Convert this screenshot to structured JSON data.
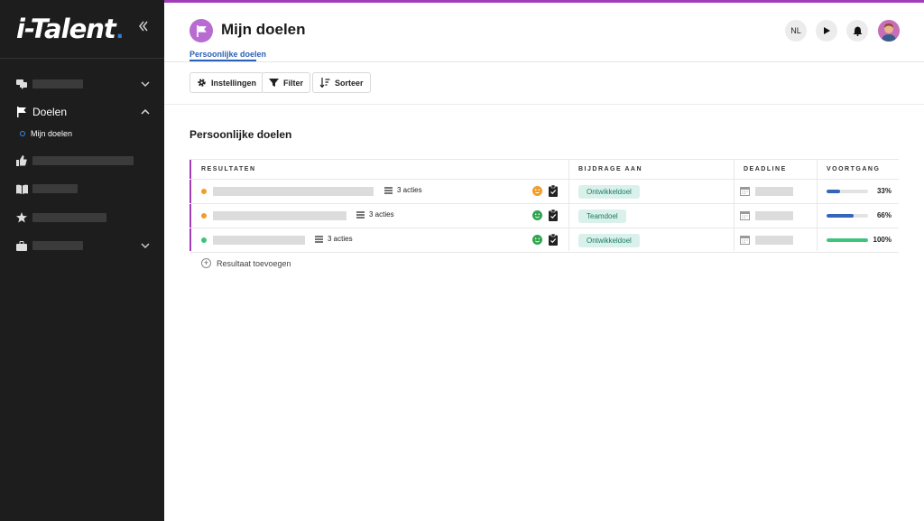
{
  "app": {
    "logo_text": "i-Talent",
    "logo_dot": "."
  },
  "sidebar": {
    "items": [
      {
        "id": "item-1",
        "label": "",
        "redacted": true,
        "icon": "chat-bubbles-icon",
        "expandable": true
      },
      {
        "id": "doelen",
        "label": "Doelen",
        "redacted": false,
        "icon": "flag-icon",
        "expandable": true,
        "expanded": true,
        "children": [
          {
            "label": "Mijn doelen",
            "active": true
          }
        ]
      },
      {
        "id": "item-3",
        "label": "",
        "redacted": true,
        "icon": "thumbs-up-icon",
        "expandable": false
      },
      {
        "id": "item-4",
        "label": "",
        "redacted": true,
        "icon": "book-icon",
        "expandable": false
      },
      {
        "id": "item-5",
        "label": "",
        "redacted": true,
        "icon": "star-icon",
        "expandable": false
      },
      {
        "id": "item-6",
        "label": "",
        "redacted": true,
        "icon": "briefcase-icon",
        "expandable": true
      }
    ]
  },
  "header": {
    "title": "Mijn doelen",
    "tab": "Persoonlijke doelen",
    "language": "NL",
    "accent_color": "#a03db8"
  },
  "toolbar": {
    "settings": "Instellingen",
    "filter": "Filter",
    "sort": "Sorteer"
  },
  "section": {
    "title": "Persoonlijke doelen"
  },
  "table": {
    "columns": [
      "RESULTATEN",
      "BIJDRAGE AAN",
      "DEADLINE",
      "VOORTGANG"
    ],
    "rows": [
      {
        "status_color": "#f39c2b",
        "acties": "3 acties",
        "mood": "neutral",
        "mood_color": "#f39c2b",
        "contribution": "Ontwikkeldoel",
        "progress": 33,
        "progress_label": "33%",
        "progress_color": "#3565b8"
      },
      {
        "status_color": "#f39c2b",
        "acties": "3 acties",
        "mood": "happy",
        "mood_color": "#2ea54f",
        "contribution": "Teamdoel",
        "progress": 66,
        "progress_label": "66%",
        "progress_color": "#3565b8"
      },
      {
        "status_color": "#3cc47c",
        "acties": "3 acties",
        "mood": "happy",
        "mood_color": "#2ea54f",
        "contribution": "Ontwikkeldoel",
        "progress": 100,
        "progress_label": "100%",
        "progress_color": "#3cc47c"
      }
    ],
    "add_label": "Resultaat toevoegen"
  }
}
